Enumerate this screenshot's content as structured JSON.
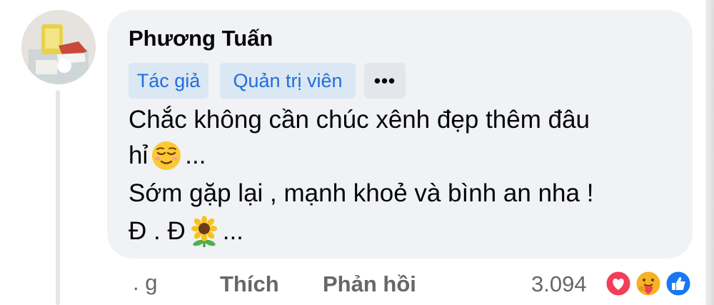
{
  "comment": {
    "author": "Phương Tuấn",
    "badges": [
      "Tác giả",
      "Quản trị viên"
    ],
    "more_label": "•••",
    "lines": [
      {
        "before": "Chắc không cần chúc xênh đẹp thêm đâu",
        "after": ""
      },
      {
        "before": "hỉ ",
        "after": "..."
      },
      {
        "before": "Sớm gặp lại , mạnh khoẻ và bình an nha !",
        "after": ""
      },
      {
        "before": "Đ . Đ",
        "after": " ..."
      }
    ]
  },
  "actions": {
    "time_label": ". g",
    "like_label": "Thích",
    "reply_label": "Phản hồi"
  },
  "reactions": {
    "count": "3.094",
    "icons": [
      "love-reaction-icon",
      "care-reaction-icon",
      "like-reaction-icon"
    ],
    "colors": {
      "love": "#f33e58",
      "care": "#f7b125",
      "like": "#1877f2"
    }
  },
  "colors": {
    "bubble": "#f0f2f5",
    "badge_bg": "#dbe7f2",
    "badge_text": "#216fdb",
    "secondary_text": "#65676b"
  }
}
